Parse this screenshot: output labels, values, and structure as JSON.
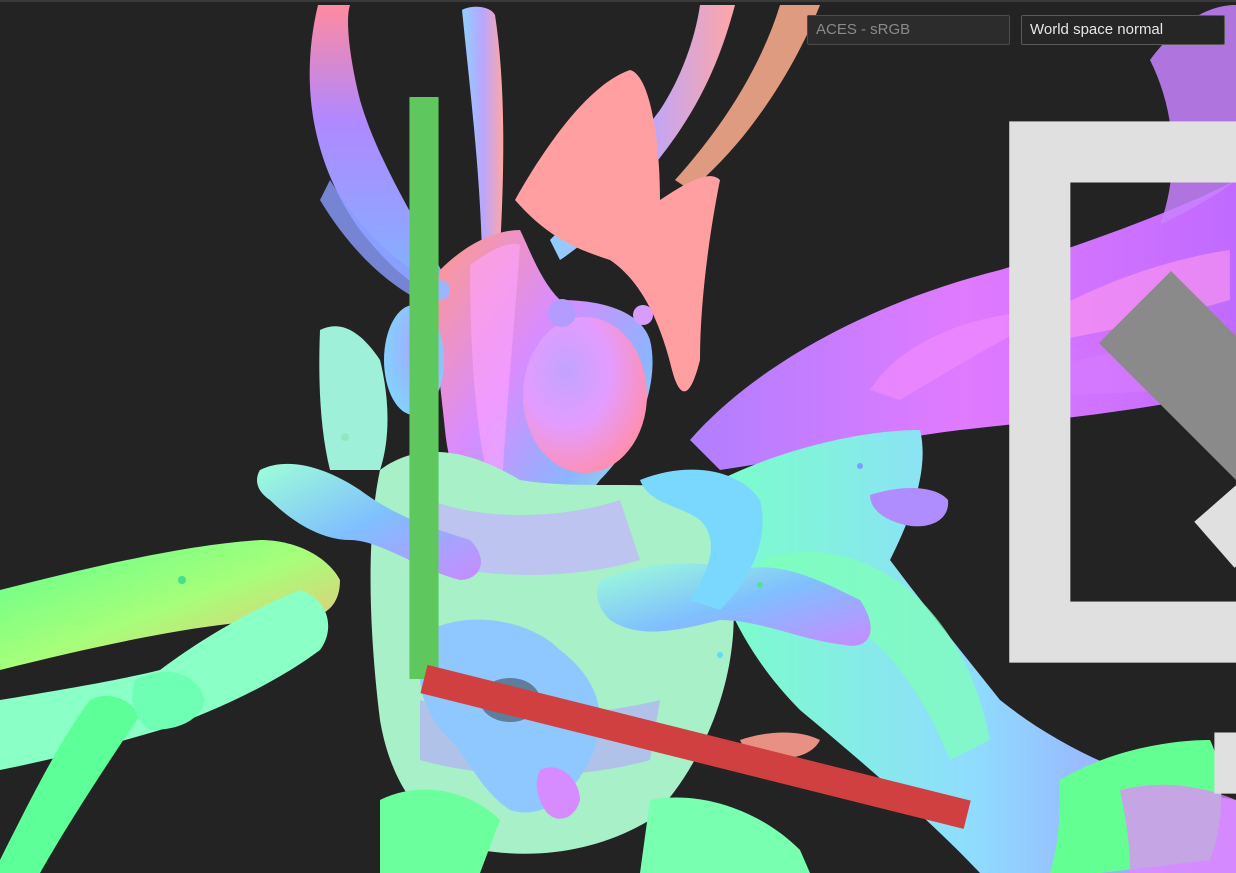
{
  "viewport": {
    "background": "#232323",
    "content": "normal-map-render"
  },
  "toolbar": {
    "display_icon": "display-settings-icon",
    "colorspace": {
      "selected": "ACES - sRGB",
      "enabled": false
    },
    "channel": {
      "selected": "World space normal",
      "enabled": true
    },
    "chevron_icon": "chevron-down-icon"
  },
  "gizmo": {
    "icon": "axis-gizmo-icon",
    "colors": {
      "x": "#d04040",
      "y": "#5ec85e"
    }
  }
}
